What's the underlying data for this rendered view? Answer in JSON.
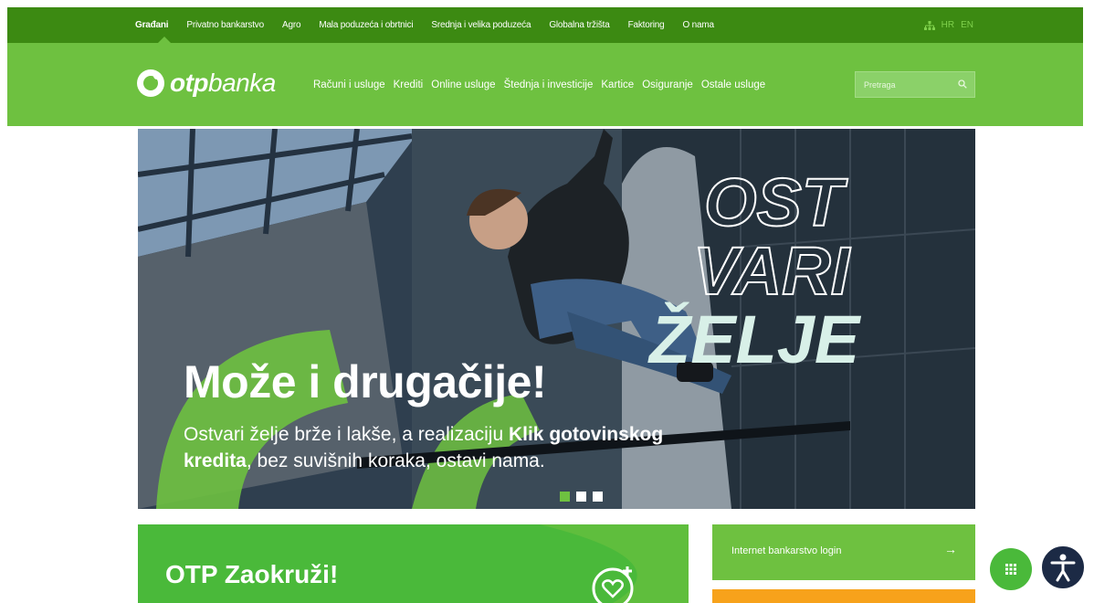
{
  "top_nav": {
    "items": [
      "Građani",
      "Privatno bankarstvo",
      "Agro",
      "Mala poduzeća i obrtnici",
      "Srednja i velika poduzeća",
      "Globalna tržišta",
      "Faktoring",
      "O nama"
    ],
    "active_index": 0
  },
  "lang": {
    "hr": "HR",
    "en": "EN"
  },
  "brand": {
    "bold": "otp",
    "rest": "banka"
  },
  "main_nav": [
    "Računi i usluge",
    "Krediti",
    "Online usluge",
    "Štednja i investicije",
    "Kartice",
    "Osiguranje",
    "Ostale usluge"
  ],
  "search": {
    "placeholder": "Pretraga"
  },
  "hero": {
    "title": "Može i drugačije!",
    "subtitle_pre": "Ostvari želje brže i lakše, a realizaciju ",
    "subtitle_bold": "Klik gotovinskog kredita",
    "subtitle_post": ", bez suvišnih koraka, ostavi nama.",
    "slogan_line1": "OST",
    "slogan_line2": "VARI",
    "slogan_line3": "ŽELJE",
    "slides": 3,
    "active_slide": 0
  },
  "promo": {
    "title": "OTP Zaokruži!"
  },
  "login": {
    "label": "Internet bankarstvo login",
    "arrow": "→"
  },
  "colors": {
    "dark_green": "#3c8a12",
    "brand_green": "#6ec140",
    "orange": "#f7a21b",
    "navy": "#1c2a45"
  }
}
